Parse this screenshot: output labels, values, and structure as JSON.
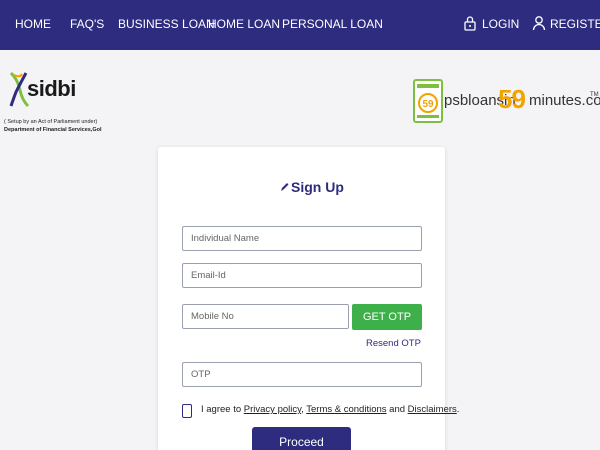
{
  "nav": {
    "home": "HOME",
    "faqs": "FAQ'S",
    "business_loan": "BUSINESS LOAN",
    "home_loan": "HOME LOAN",
    "personal_loan": "PERSONAL LOAN",
    "login": "LOGIN",
    "register": "REGISTER",
    "background_color": "#2e2c7e"
  },
  "header": {
    "sidbi_brand": "sidbi",
    "sidbi_tagline_1": "( Setup by an Act of Parliament under)",
    "sidbi_tagline_2": "Department of Financial Services,GoI",
    "psb_part1": "psbloansin",
    "psb_number": "59",
    "psb_part2": "minutes.com",
    "psb_tm": "TM",
    "psb_badge_text": "PSB LOANS IN 59 MINUTES"
  },
  "form": {
    "title": "Sign Up",
    "name_placeholder": "Individual Name",
    "email_placeholder": "Email-Id",
    "mobile_placeholder": "Mobile No",
    "otp_placeholder": "OTP",
    "get_otp_label": "GET OTP",
    "resend_otp_label": "Resend OTP",
    "agree_prefix": "I agree to",
    "privacy_policy": "Privacy policy",
    "comma": ",",
    "terms": "Terms & conditions",
    "and": "and",
    "disclaimers": "Disclaimers",
    "period": ".",
    "proceed_label": "Proceed",
    "accent_color": "#2e2c7e",
    "otp_button_color": "#3eb049"
  }
}
